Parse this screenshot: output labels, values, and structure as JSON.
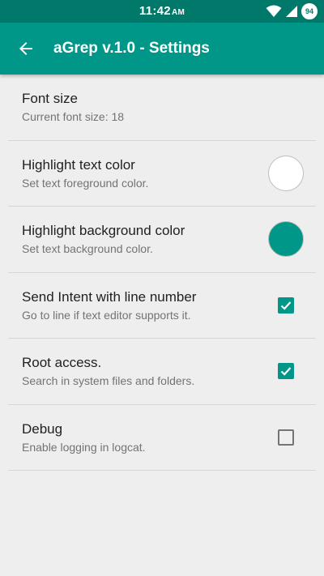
{
  "status_bar": {
    "time": "11:42",
    "ampm": "AM",
    "battery_level": "94",
    "wifi_icon": "wifi-icon",
    "signal_icon": "signal-icon"
  },
  "app_bar": {
    "title": "aGrep v.1.0 - Settings",
    "back_icon": "arrow-back-icon"
  },
  "colors": {
    "status_bar": "#00796b",
    "app_bar": "#009688",
    "accent": "#009688",
    "background": "#eeeeee"
  },
  "settings": {
    "font_size": {
      "title": "Font size",
      "summary": "Current font size: 18"
    },
    "highlight_text": {
      "title": "Highlight text color",
      "summary": "Set text foreground color.",
      "color": "#ffffff"
    },
    "highlight_bg": {
      "title": "Highlight background color",
      "summary": "Set text background color.",
      "color": "#009688"
    },
    "send_intent": {
      "title": "Send Intent with line number",
      "summary": "Go to line if text editor supports it.",
      "checked": true
    },
    "root_access": {
      "title": "Root access.",
      "summary": "Search in system files and folders.",
      "checked": true
    },
    "debug": {
      "title": "Debug",
      "summary": "Enable logging in logcat.",
      "checked": false
    }
  }
}
